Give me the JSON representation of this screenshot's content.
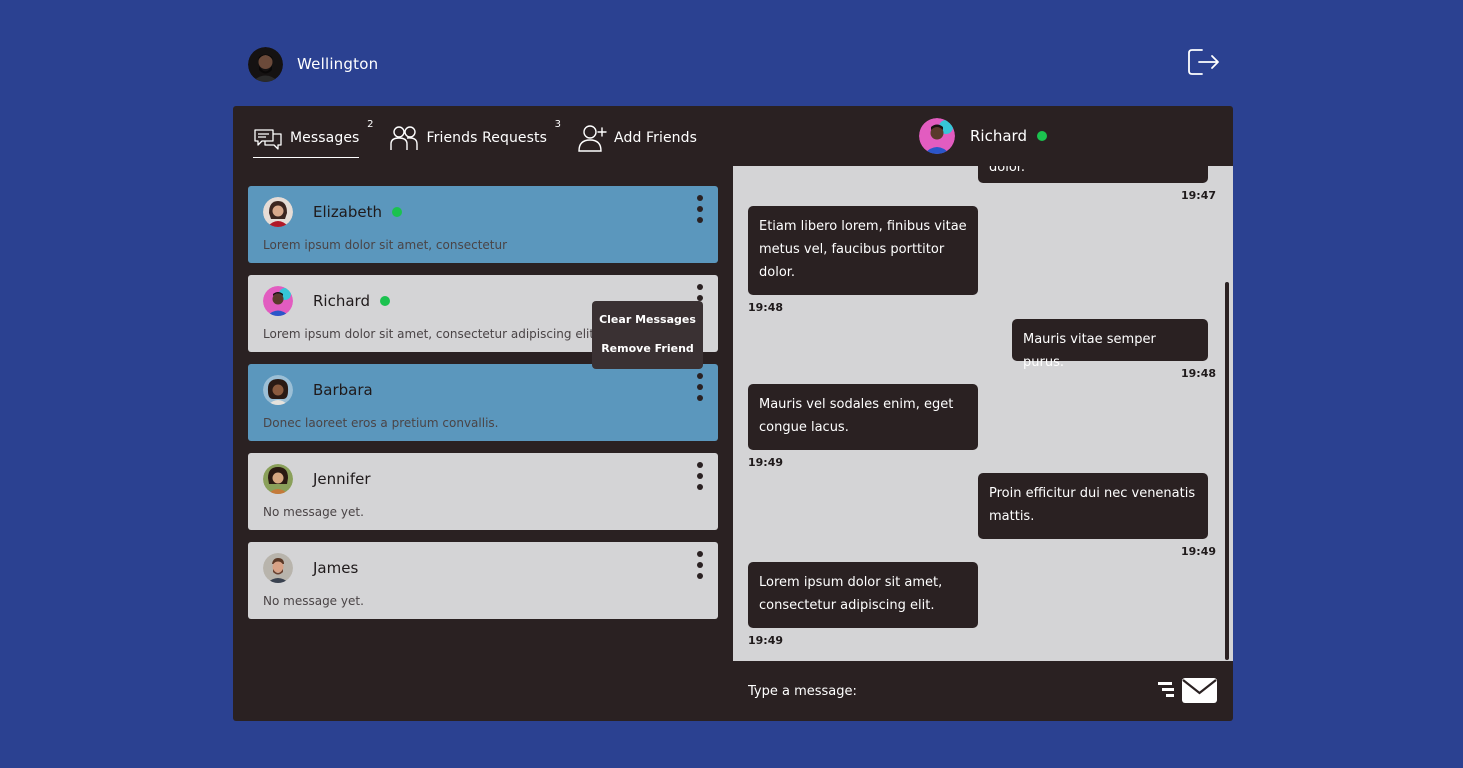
{
  "user": {
    "name": "Wellington",
    "avatar_icon": "user-avatar"
  },
  "header": {
    "logout_icon": "logout-icon"
  },
  "tabs": [
    {
      "label": "Messages",
      "badge": "2",
      "icon": "chat-bubbles-icon"
    },
    {
      "label": "Friends Requests",
      "badge": "3",
      "icon": "users-icon"
    },
    {
      "label": "Add Friends",
      "badge": "",
      "icon": "user-plus-icon"
    }
  ],
  "friends": [
    {
      "name": "Elizabeth",
      "online": true,
      "last_message": "Lorem ipsum dolor sit amet, consectetur",
      "highlight": true
    },
    {
      "name": "Richard",
      "online": true,
      "last_message": "Lorem ipsum dolor sit amet, consectetur adipiscing elit.",
      "highlight": false
    },
    {
      "name": "Barbara",
      "online": false,
      "last_message": "Donec laoreet eros a pretium convallis.",
      "highlight": true
    },
    {
      "name": "Jennifer",
      "online": false,
      "last_message": "No message yet.",
      "highlight": false
    },
    {
      "name": "James",
      "online": false,
      "last_message": "No message yet.",
      "highlight": false
    }
  ],
  "context_menu": {
    "items": [
      "Clear Messages",
      "Remove Friend"
    ]
  },
  "chat": {
    "contact_name": "Richard",
    "contact_online": true,
    "messages": [
      {
        "text": "dolor.",
        "time": "19:47",
        "side": "right"
      },
      {
        "text": "Etiam libero lorem, finibus vitae metus vel, faucibus porttitor dolor.",
        "time": "19:48",
        "side": "left"
      },
      {
        "text": "Mauris vitae semper purus.",
        "time": "19:48",
        "side": "right"
      },
      {
        "text": "Mauris vel sodales enim, eget congue lacus.",
        "time": "19:49",
        "side": "left"
      },
      {
        "text": "Proin efficitur dui nec venenatis mattis.",
        "time": "19:49",
        "side": "right"
      },
      {
        "text": "Lorem ipsum dolor sit amet, consectetur adipiscing elit.",
        "time": "19:49",
        "side": "left"
      }
    ],
    "input_placeholder": "Type a message:",
    "send_icon": "send-mail-icon"
  },
  "colors": {
    "page_bg": "#2b4191",
    "panel_bg": "#2a2122",
    "card_light": "#d4d4d6",
    "card_highlight": "#5b97bd",
    "online": "#1bc24f"
  }
}
